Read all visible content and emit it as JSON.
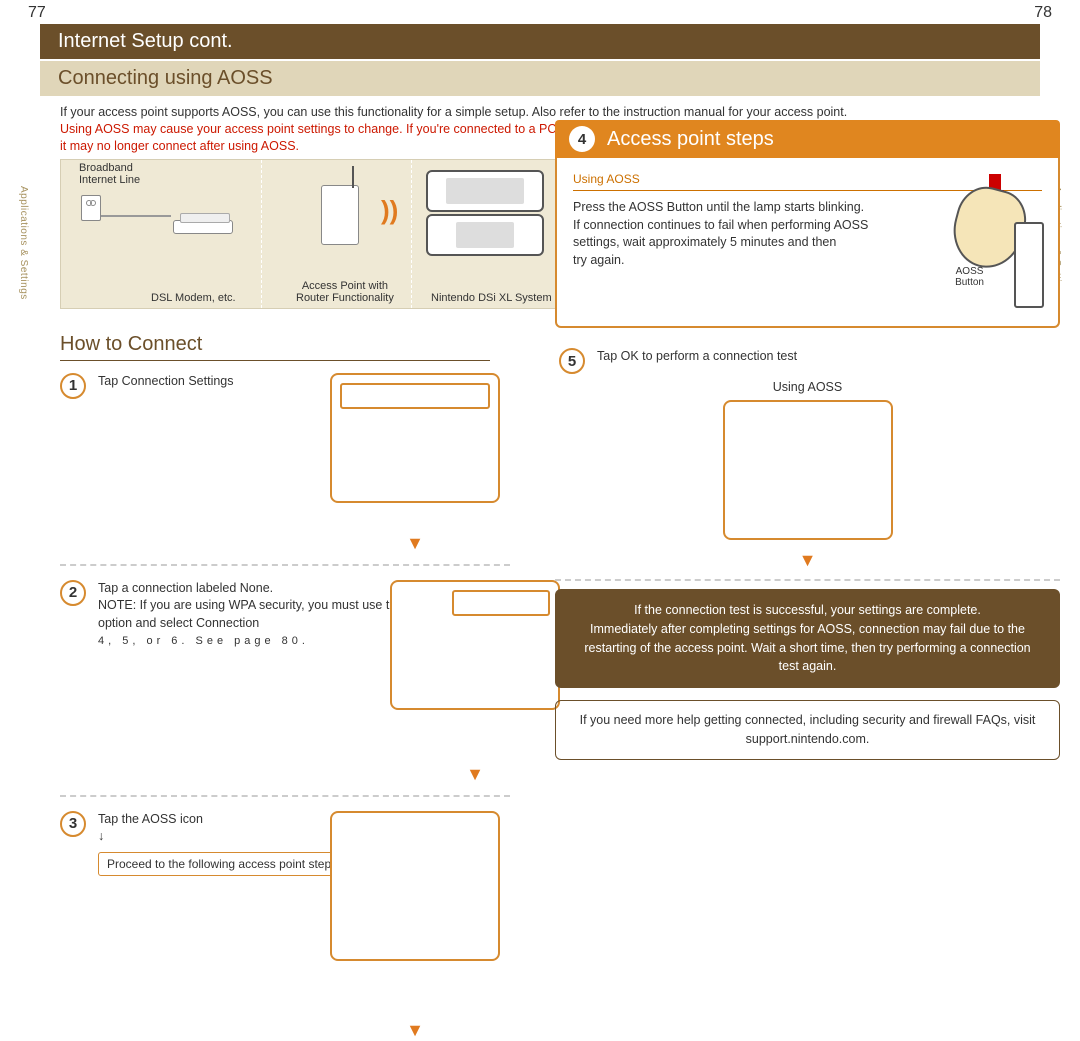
{
  "page_left": "77",
  "page_right": "78",
  "side_label": "Applications & Settings",
  "header": "Internet Setup cont.",
  "subheader": "Connecting using AOSS",
  "intro_line1": "If your access point supports AOSS, you can use this functionality for a simple setup. Also refer to the instruction manual for your access point.",
  "intro_warn1": "Using AOSS may cause your access point settings to change. If you're connected to a PC without using AOSS,",
  "intro_warn2": "it may no longer connect after using AOSS.",
  "diagram": {
    "broadband": "Broadband\nInternet Line",
    "modem": "DSL Modem, etc.",
    "router": "Access Point with\nRouter Functionality",
    "ds": "Nintendo DSi XL System"
  },
  "how_title": "How to Connect",
  "steps": [
    {
      "num": "1",
      "text": "Tap Connection Settings"
    },
    {
      "num": "2",
      "text": "Tap a connection labeled None.",
      "note1": "NOTE: If you are using WPA security, you must use the Advanced Setup option and select Connection",
      "note2": "4, 5, or 6. See page 80."
    },
    {
      "num": "3",
      "text": "Tap the AOSS icon",
      "arrow": "↓",
      "proceed": "Proceed to the following access point steps."
    }
  ],
  "ap": {
    "num": "4",
    "title": "Access point steps",
    "sub": "Using AOSS",
    "text": "Press the AOSS Button until the lamp starts blinking.\nIf connection continues to fail when performing AOSS settings, wait approximately 5 minutes and then\ntry again.",
    "btn_label": "AOSS\nButton"
  },
  "step5": {
    "num": "5",
    "text": "Tap OK to perform a connection test",
    "caption": "Using AOSS"
  },
  "success": "If the connection test is successful, your settings are complete.\nImmediately after completing settings for AOSS, connection may fail due to the restarting of the access point. Wait a short time, then try performing a connection test again.",
  "help": "If you need more help getting connected, including security and firewall FAQs, visit support.nintendo.com."
}
